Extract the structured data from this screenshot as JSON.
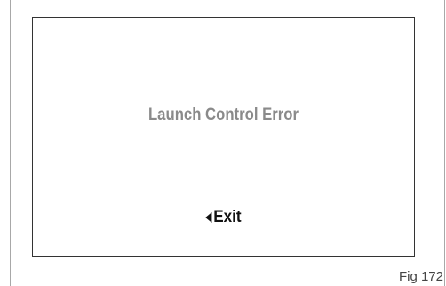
{
  "screen": {
    "message": "Launch Control Error",
    "exit": {
      "icon": "back-arrow-icon",
      "label": "Exit"
    }
  },
  "caption": "Fig 172",
  "colors": {
    "message_text": "#8a8a8a",
    "exit_text": "#111111",
    "screen_border": "#333333"
  }
}
